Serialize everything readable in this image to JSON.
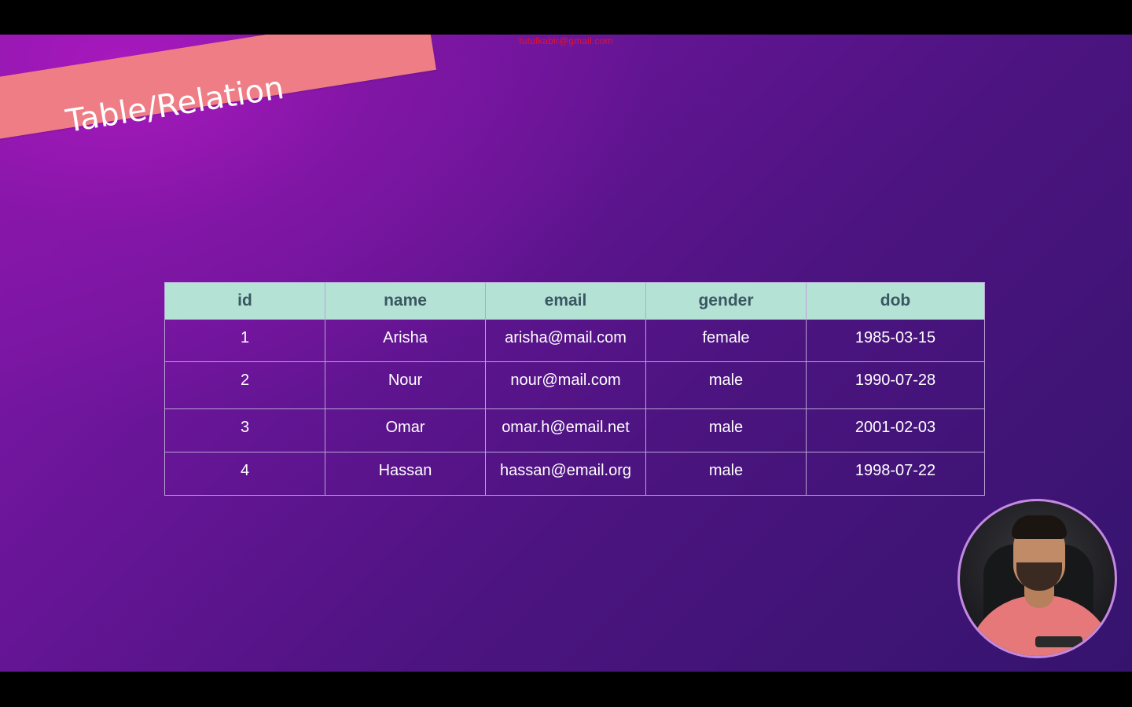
{
  "watermark": "tutulkabir@gmail.com",
  "slide": {
    "title": "Table/Relation"
  },
  "table": {
    "columns": [
      "id",
      "name",
      "email",
      "gender",
      "dob"
    ],
    "rows": [
      [
        "1",
        "Arisha",
        "arisha@mail.com",
        "female",
        "1985-03-15"
      ],
      [
        "2",
        "Nour",
        "nour@mail.com",
        "male",
        "1990-07-28"
      ],
      [
        "3",
        "Omar",
        "omar.h@email.net",
        "male",
        "2001-02-03"
      ],
      [
        "4",
        "Hassan",
        "hassan@email.org",
        "male",
        "1998-07-22"
      ]
    ]
  },
  "colors": {
    "banner": "#ef7d86",
    "header_bg": "#b4e3d5",
    "header_text": "#3b5663",
    "watermark": "#e0142a"
  }
}
